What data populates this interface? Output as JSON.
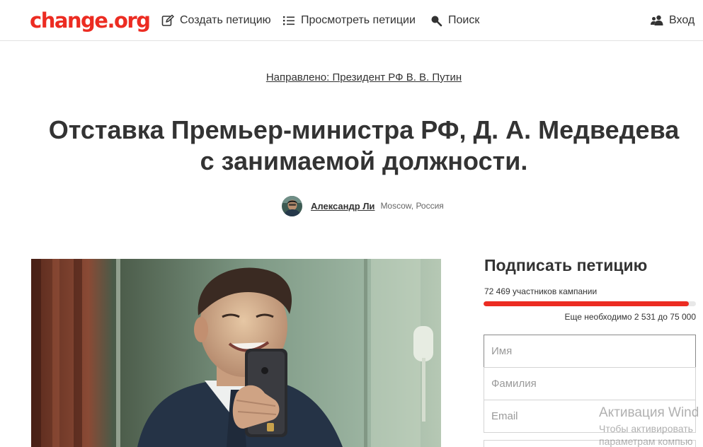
{
  "header": {
    "logo": "change.org",
    "nav": {
      "create": "Создать петицию",
      "browse": "Просмотреть петиции",
      "search": "Поиск",
      "login": "Вход"
    },
    "icons": {
      "create": "pencil-square-icon",
      "browse": "list-icon",
      "search": "search-icon",
      "login": "users-icon"
    }
  },
  "petition": {
    "target": "Направлено: Президент РФ В. В. Путин",
    "title": "Отставка Премьер-министра РФ, Д. А. Медведева с занимаемой должности.",
    "author": {
      "name": "Александр Ли",
      "location": "Moscow, Россия"
    }
  },
  "sign": {
    "title": "Подписать петицию",
    "count_text": "72 469 участников кампании",
    "progress": 0.966,
    "need_text": "Еще необходимо 2 531 до 75 000",
    "fields": {
      "first_name_placeholder": "Имя",
      "last_name_placeholder": "Фамилия",
      "email_placeholder": "Email"
    }
  },
  "watermark": {
    "title": "Активация Wind",
    "line1": "Чтобы активировать",
    "line2": "параметрам компью"
  },
  "colors": {
    "brand": "#ec2c22",
    "text": "#333333"
  }
}
